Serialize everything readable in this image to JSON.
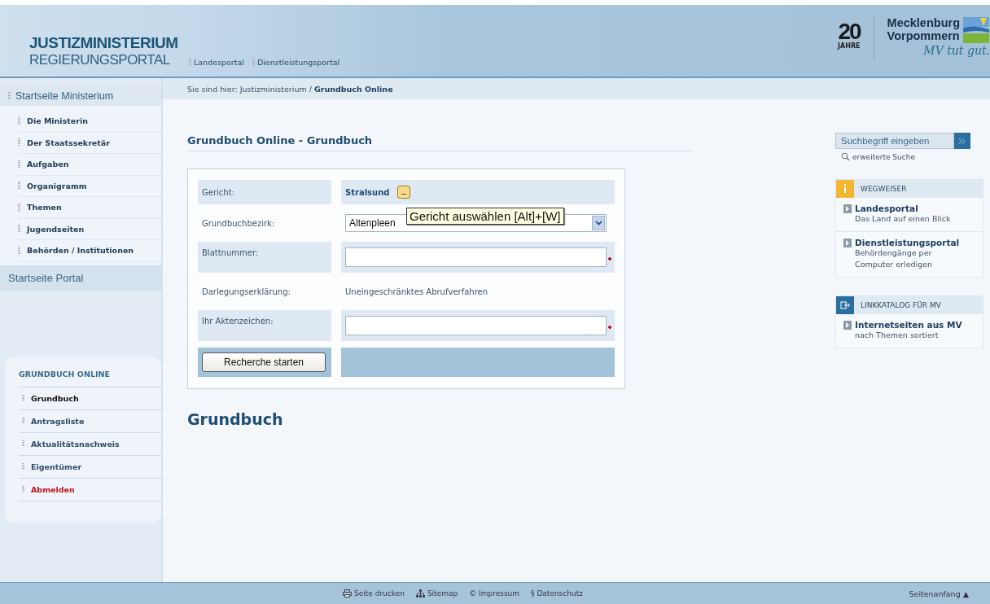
{
  "header": {
    "title": "JUSTIZMINISTERIUM",
    "subtitle": "REGIERUNGSPORTAL",
    "links": [
      "Landesportal",
      "Dienstleistungsportal"
    ],
    "badge_number": "20",
    "badge_caption": "JAHRE",
    "brand_lines": [
      "Mecklenburg",
      "Vorpommern"
    ],
    "slogan": "MV tut gut."
  },
  "breadcrumb": {
    "prefix": "Sie sind hier:",
    "trail": [
      "Justizministerium /"
    ],
    "current": "Grundbuch Online"
  },
  "sidebar": {
    "home": "Startseite Ministerium",
    "items": [
      "Die Ministerin",
      "Der Staatssekretär",
      "Aufgaben",
      "Organigramm",
      "Themen",
      "Jugendseiten",
      "Behörden / Institutionen"
    ],
    "portal": "Startseite Portal",
    "panel": {
      "title": "GRUNDBUCH ONLINE",
      "items": [
        {
          "label": "Grundbuch",
          "selected": true,
          "kind": "link"
        },
        {
          "label": "Antragsliste",
          "selected": false,
          "kind": "link"
        },
        {
          "label": "Aktualitätsnachweis",
          "selected": false,
          "kind": "link"
        },
        {
          "label": "Eigentümer",
          "selected": false,
          "kind": "link"
        },
        {
          "label": "Abmelden",
          "selected": false,
          "kind": "logout"
        }
      ]
    }
  },
  "form": {
    "title": "Grundbuch Online - Grundbuch",
    "rows": [
      {
        "kind": "value",
        "label": "Gericht:",
        "value": "Stralsund"
      },
      {
        "kind": "select",
        "label": "Grundbuchbezirk:",
        "value": "Altenpleen"
      },
      {
        "kind": "input",
        "label": "Blattnummer:",
        "required": true
      },
      {
        "kind": "text",
        "label": "Darlegungserklärung:",
        "value": "Uneingeschränktes Abrufverfahren"
      },
      {
        "kind": "input",
        "label": "Ihr Aktenzeichen:",
        "required": true
      }
    ],
    "submit": "Recherche starten",
    "tooltip": "Gericht auswählen [Alt]+[W]"
  },
  "section_heading": "Grundbuch",
  "search": {
    "placeholder": "Suchbegriff eingeben",
    "advanced": "erweiterte Suche"
  },
  "boxes": [
    {
      "kind": "info",
      "title": "WEGWEISER",
      "links": [
        {
          "title": "Landesportal",
          "desc": "Das Land auf einen Blick"
        },
        {
          "title": "Dienstleistungsportal",
          "desc": "Behördengänge per Computer erledigen"
        }
      ]
    },
    {
      "kind": "catalog",
      "title": "LINKKATALOG FÜR MV",
      "links": [
        {
          "title": "Internetseiten aus MV",
          "desc": "nach Themen sortiert"
        }
      ]
    }
  ],
  "footer": {
    "links": [
      {
        "kind": "print",
        "label": "Seite drucken"
      },
      {
        "kind": "sitemap",
        "label": "Sitemap"
      },
      {
        "kind": "text",
        "label": "© Impressum"
      },
      {
        "kind": "text",
        "label": "§ Datenschutz"
      }
    ],
    "top": "Seitenanfang ▲"
  }
}
